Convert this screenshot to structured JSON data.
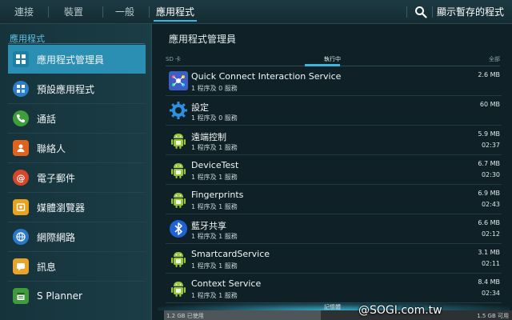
{
  "top_tabs": [
    {
      "label": "連接"
    },
    {
      "label": "裝置"
    },
    {
      "label": "一般"
    },
    {
      "label": "應用程式"
    }
  ],
  "show_cached_label": "顯示暫存的程式",
  "sidebar": {
    "header": "應用程式",
    "items": [
      {
        "label": "應用程式管理員",
        "icon": "grid-icon"
      },
      {
        "label": "預設應用程式",
        "icon": "default-apps-icon"
      },
      {
        "label": "通話",
        "icon": "phone-icon"
      },
      {
        "label": "聯絡人",
        "icon": "contacts-icon"
      },
      {
        "label": "電子郵件",
        "icon": "email-icon"
      },
      {
        "label": "媒體瀏覽器",
        "icon": "media-browser-icon"
      },
      {
        "label": "網際網路",
        "icon": "globe-icon"
      },
      {
        "label": "訊息",
        "icon": "messages-icon"
      },
      {
        "label": "S Planner",
        "icon": "calendar-icon"
      }
    ]
  },
  "main": {
    "title": "應用程式管理員",
    "segments": {
      "sd": "SD 卡",
      "running": "執行中",
      "all": "全部"
    },
    "apps": [
      {
        "name": "Quick Connect Interaction Service",
        "sub": "1 程序及 0 服務",
        "size": "2.6 MB",
        "time": "",
        "icon": "quick-connect-icon"
      },
      {
        "name": "設定",
        "sub": "1 程序及 0 服務",
        "size": "60 MB",
        "time": "",
        "icon": "settings-gear-icon"
      },
      {
        "name": "遠端控制",
        "sub": "1 程序及 1 服務",
        "size": "5.9 MB",
        "time": "02:37",
        "icon": "android-icon"
      },
      {
        "name": "DeviceTest",
        "sub": "1 程序及 1 服務",
        "size": "6.7 MB",
        "time": "02:30",
        "icon": "android-icon"
      },
      {
        "name": "Fingerprints",
        "sub": "1 程序及 1 服務",
        "size": "6.9 MB",
        "time": "02:43",
        "icon": "android-icon"
      },
      {
        "name": "藍牙共享",
        "sub": "1 程序及 1 服務",
        "size": "6.6 MB",
        "time": "02:12",
        "icon": "bluetooth-icon"
      },
      {
        "name": "SmartcardService",
        "sub": "1 程序及 1 服務",
        "size": "3.1 MB",
        "time": "02:11",
        "icon": "android-icon"
      },
      {
        "name": "Context Service",
        "sub": "1 程序及 1 服務",
        "size": "8.4 MB",
        "time": "02:34",
        "icon": "android-icon"
      }
    ]
  },
  "storage": {
    "title": "記憶體",
    "used_label": "1.2 GB 已使用",
    "free_label": "1.5 GB 可用",
    "used_fraction": 0.45
  },
  "watermark": "@SOGI.com.tw"
}
